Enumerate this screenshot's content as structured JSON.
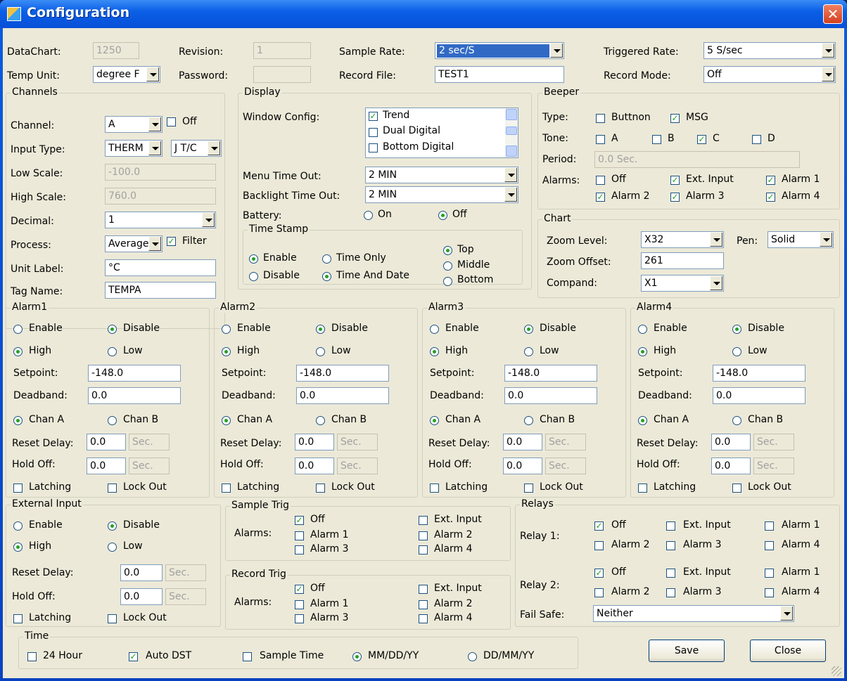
{
  "window": {
    "title": "Configuration"
  },
  "top": {
    "datachart_label": "DataChart:",
    "datachart_value": "1250",
    "revision_label": "Revision:",
    "revision_value": "1",
    "sample_rate_label": "Sample Rate:",
    "sample_rate_value": "2 sec/S",
    "triggered_rate_label": "Triggered Rate:",
    "triggered_rate_value": "5 S/sec",
    "temp_unit_label": "Temp Unit:",
    "temp_unit_value": "degree F",
    "password_label": "Password:",
    "password_value": "",
    "record_file_label": "Record File:",
    "record_file_value": "TEST1",
    "record_mode_label": "Record Mode:",
    "record_mode_value": "Off"
  },
  "channels": {
    "title": "Channels",
    "channel_label": "Channel:",
    "channel_value": "A",
    "off_label": "Off",
    "input_type_label": "Input Type:",
    "input_type_value": "THERM",
    "input_type2_value": "J T/C",
    "low_scale_label": "Low Scale:",
    "low_scale_value": "-100.0",
    "high_scale_label": "High Scale:",
    "high_scale_value": "760.0",
    "decimal_label": "Decimal:",
    "decimal_value": "1",
    "process_label": "Process:",
    "process_value": "Average",
    "filter_label": "Filter",
    "unit_label_label": "Unit Label:",
    "unit_label_value": "°C",
    "tag_name_label": "Tag Name:",
    "tag_name_value": "TEMPA"
  },
  "display": {
    "title": "Display",
    "window_config_label": "Window Config:",
    "window_items": [
      "Trend",
      "Dual Digital",
      "Bottom Digital"
    ],
    "menu_timeout_label": "Menu Time Out:",
    "menu_timeout_value": "2 MIN",
    "backlight_label": "Backlight Time Out:",
    "backlight_value": "2 MIN",
    "battery_label": "Battery:",
    "battery_on": "On",
    "battery_off": "Off",
    "timestamp_title": "Time Stamp",
    "ts_enable": "Enable",
    "ts_disable": "Disable",
    "ts_time_only": "Time Only",
    "ts_time_date": "Time And Date",
    "ts_top": "Top",
    "ts_middle": "Middle",
    "ts_bottom": "Bottom"
  },
  "beeper": {
    "title": "Beeper",
    "type_label": "Type:",
    "buttnon": "Buttnon",
    "msg": "MSG",
    "tone_label": "Tone:",
    "tone_a": "A",
    "tone_b": "B",
    "tone_c": "C",
    "tone_d": "D",
    "period_label": "Period:",
    "period_value": "0.0 Sec.",
    "alarms_label": "Alarms:",
    "a_off": "Off",
    "a_ext": "Ext. Input",
    "a_1": "Alarm 1",
    "a_2": "Alarm 2",
    "a_3": "Alarm 3",
    "a_4": "Alarm 4"
  },
  "chart": {
    "title": "Chart",
    "zoom_level_label": "Zoom Level:",
    "zoom_level_value": "X32",
    "pen_label": "Pen:",
    "pen_value": "Solid",
    "zoom_offset_label": "Zoom Offset:",
    "zoom_offset_value": "261",
    "compand_label": "Compand:",
    "compand_value": "X1"
  },
  "alarm_common": {
    "enable": "Enable",
    "disable": "Disable",
    "high": "High",
    "low": "Low",
    "setpoint_label": "Setpoint:",
    "deadband_label": "Deadband:",
    "chan_a": "Chan A",
    "chan_b": "Chan B",
    "reset_delay_label": "Reset Delay:",
    "hold_off_label": "Hold Off:",
    "sec": "Sec.",
    "latching": "Latching",
    "lock_out": "Lock Out"
  },
  "alarms": [
    {
      "title": "Alarm1",
      "setpoint": "-148.0",
      "deadband": "0.0",
      "reset_delay": "0.0",
      "hold_off": "0.0"
    },
    {
      "title": "Alarm2",
      "setpoint": "-148.0",
      "deadband": "0.0",
      "reset_delay": "0.0",
      "hold_off": "0.0"
    },
    {
      "title": "Alarm3",
      "setpoint": "-148.0",
      "deadband": "0.0",
      "reset_delay": "0.0",
      "hold_off": "0.0"
    },
    {
      "title": "Alarm4",
      "setpoint": "-148.0",
      "deadband": "0.0",
      "reset_delay": "0.0",
      "hold_off": "0.0"
    }
  ],
  "external": {
    "title": "External Input",
    "reset_delay": "0.0",
    "hold_off": "0.0"
  },
  "sample_trig": {
    "title": "Sample Trig",
    "alarms_label": "Alarms:",
    "off": "Off",
    "a1": "Alarm 1",
    "a3": "Alarm 3",
    "ext": "Ext. Input",
    "a2": "Alarm 2",
    "a4": "Alarm 4"
  },
  "record_trig": {
    "title": "Record Trig",
    "alarms_label": "Alarms:",
    "off": "Off",
    "a1": "Alarm 1",
    "a3": "Alarm 3",
    "ext": "Ext. Input",
    "a2": "Alarm 2",
    "a4": "Alarm 4"
  },
  "relays": {
    "title": "Relays",
    "relay1_label": "Relay 1:",
    "relay2_label": "Relay 2:",
    "off": "Off",
    "ext": "Ext. Input",
    "a1": "Alarm 1",
    "a2": "Alarm 2",
    "a3": "Alarm 3",
    "a4": "Alarm 4",
    "fail_safe_label": "Fail Safe:",
    "fail_safe_value": "Neither"
  },
  "time": {
    "title": "Time",
    "h24": "24 Hour",
    "auto_dst": "Auto DST",
    "sample_time": "Sample Time",
    "mmddyy": "MM/DD/YY",
    "ddmmyy": "DD/MM/YY"
  },
  "buttons": {
    "save": "Save",
    "close": "Close"
  }
}
